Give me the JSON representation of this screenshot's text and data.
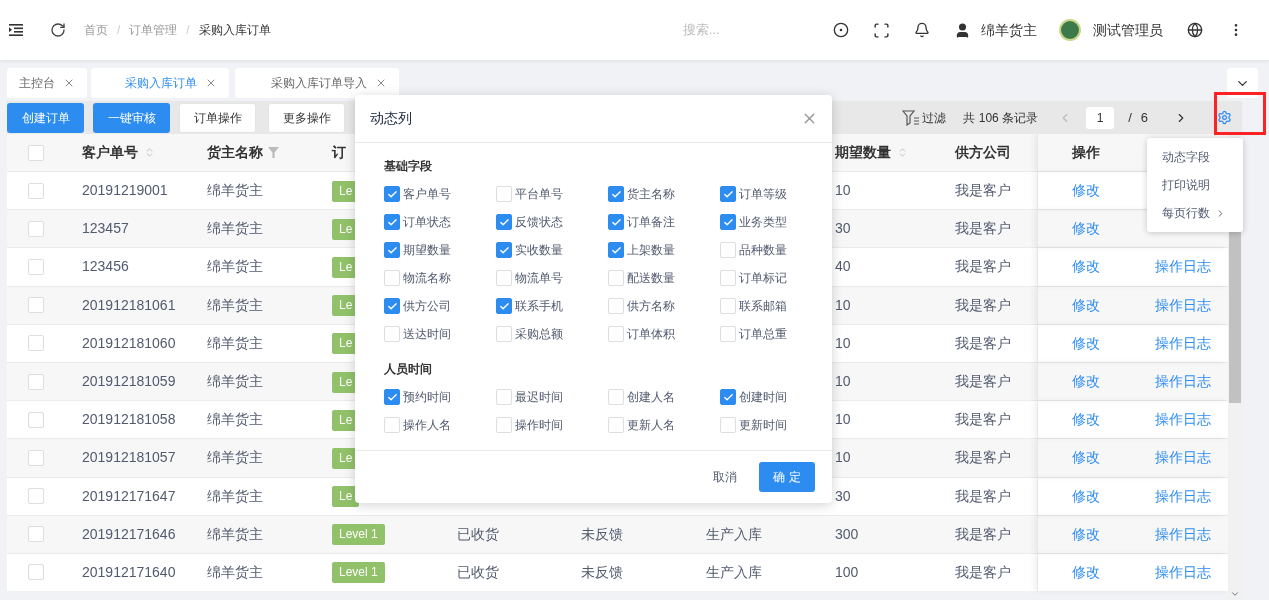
{
  "header": {
    "breadcrumbs": [
      "首页",
      "订单管理",
      "采购入库订单"
    ],
    "breadcrumb_separator": "/",
    "search": {
      "placeholder": "搜索..."
    },
    "user": "绵羊货主",
    "admin": "测试管理员"
  },
  "tabs": [
    {
      "label": "主控台",
      "selected": false
    },
    {
      "label": "采购入库订单",
      "selected": true
    },
    {
      "label": "采购入库订单导入",
      "selected": false
    }
  ],
  "toolbar": {
    "buttons": [
      {
        "label": "创建订单",
        "kind": "primary"
      },
      {
        "label": "一键审核",
        "kind": "primary"
      },
      {
        "label": "订单操作",
        "kind": "default"
      },
      {
        "label": "更多操作",
        "kind": "default"
      }
    ],
    "filter": "过滤",
    "record_count": "共 106 条记录",
    "pagination": {
      "page": "1",
      "separator": "/",
      "total": "6"
    },
    "settings": {
      "highlighted": true
    }
  },
  "table": {
    "header_checked": false,
    "columns": [
      {
        "label": "客户单号",
        "sortable": true
      },
      {
        "label": "货主名称",
        "filterable": true
      },
      {
        "label": "订"
      },
      {},
      {},
      {},
      {
        "label": "期望数量",
        "sortable": true
      },
      {
        "label": "供方公司"
      },
      {
        "label": "操作"
      }
    ],
    "rows": [
      {
        "checked": false,
        "customer_no": "20191219001",
        "owner": "绵羊货主",
        "level": "Le",
        "quantity": "10",
        "supplier": "我是客户",
        "edit": "修改"
      },
      {
        "checked": false,
        "customer_no": "123457",
        "owner": "绵羊货主",
        "level": "Le",
        "quantity": "30",
        "supplier": "我是客户",
        "edit": "修改"
      },
      {
        "checked": false,
        "customer_no": "123456",
        "owner": "绵羊货主",
        "level": "Le",
        "quantity": "40",
        "supplier": "我是客户",
        "edit": "修改",
        "log": "操作日志"
      },
      {
        "checked": false,
        "customer_no": "201912181061",
        "owner": "绵羊货主",
        "level": "Le",
        "quantity": "10",
        "supplier": "我是客户",
        "edit": "修改",
        "log": "操作日志"
      },
      {
        "checked": false,
        "customer_no": "201912181060",
        "owner": "绵羊货主",
        "level": "Le",
        "quantity": "10",
        "supplier": "我是客户",
        "edit": "修改",
        "log": "操作日志"
      },
      {
        "checked": false,
        "customer_no": "201912181059",
        "owner": "绵羊货主",
        "level": "Le",
        "quantity": "10",
        "supplier": "我是客户",
        "edit": "修改",
        "log": "操作日志"
      },
      {
        "checked": false,
        "customer_no": "201912181058",
        "owner": "绵羊货主",
        "level": "Le",
        "quantity": "10",
        "supplier": "我是客户",
        "edit": "修改",
        "log": "操作日志"
      },
      {
        "checked": false,
        "customer_no": "201912181057",
        "owner": "绵羊货主",
        "level": "Le",
        "quantity": "10",
        "supplier": "我是客户",
        "edit": "修改",
        "log": "操作日志"
      },
      {
        "checked": false,
        "customer_no": "201912171647",
        "owner": "绵羊货主",
        "level": "Le",
        "quantity": "30",
        "supplier": "我是客户",
        "edit": "修改",
        "log": "操作日志"
      },
      {
        "checked": false,
        "customer_no": "201912171646",
        "owner": "绵羊货主",
        "level": "Level 1",
        "status": "已收货",
        "feedback": "未反馈",
        "type": "生产入库",
        "quantity": "300",
        "supplier": "我是客户",
        "edit": "修改",
        "log": "操作日志"
      },
      {
        "checked": false,
        "customer_no": "201912171640",
        "owner": "绵羊货主",
        "level": "Level 1",
        "status": "已收货",
        "feedback": "未反馈",
        "type": "生产入库",
        "quantity": "100",
        "supplier": "我是客户",
        "edit": "修改",
        "log": "操作日志"
      }
    ]
  },
  "modal": {
    "title": "动态列",
    "sections": [
      {
        "title": "基础字段",
        "options": [
          {
            "label": "客户单号",
            "checked": true
          },
          {
            "label": "平台单号",
            "checked": false
          },
          {
            "label": "货主名称",
            "checked": true
          },
          {
            "label": "订单等级",
            "checked": true
          },
          {
            "label": "订单状态",
            "checked": true
          },
          {
            "label": "反馈状态",
            "checked": true
          },
          {
            "label": "订单备注",
            "checked": true
          },
          {
            "label": "业务类型",
            "checked": true
          },
          {
            "label": "期望数量",
            "checked": true
          },
          {
            "label": "实收数量",
            "checked": true
          },
          {
            "label": "上架数量",
            "checked": true
          },
          {
            "label": "品种数量",
            "checked": false
          },
          {
            "label": "物流名称",
            "checked": false
          },
          {
            "label": "物流单号",
            "checked": false
          },
          {
            "label": "配送数量",
            "checked": false
          },
          {
            "label": "订单标记",
            "checked": false
          },
          {
            "label": "供方公司",
            "checked": true
          },
          {
            "label": "联系手机",
            "checked": true
          },
          {
            "label": "供方名称",
            "checked": false
          },
          {
            "label": "联系邮箱",
            "checked": false
          },
          {
            "label": "送达时间",
            "checked": false
          },
          {
            "label": "采购总额",
            "checked": false
          },
          {
            "label": "订单体积",
            "checked": false
          },
          {
            "label": "订单总重",
            "checked": false
          }
        ]
      },
      {
        "title": "人员时间",
        "options": [
          {
            "label": "预约时间",
            "checked": true
          },
          {
            "label": "最迟时间",
            "checked": false
          },
          {
            "label": "创建人名",
            "checked": false
          },
          {
            "label": "创建时间",
            "checked": true
          },
          {
            "label": "操作人名",
            "checked": false
          },
          {
            "label": "操作时间",
            "checked": false
          },
          {
            "label": "更新人名",
            "checked": false
          },
          {
            "label": "更新时间",
            "checked": false
          }
        ]
      }
    ],
    "cancel": "取消",
    "confirm": "确 定"
  },
  "menu": {
    "items": [
      {
        "label": "动态字段",
        "submenu": false
      },
      {
        "label": "打印说明",
        "submenu": false
      },
      {
        "label": "每页行数",
        "submenu": true
      }
    ]
  }
}
